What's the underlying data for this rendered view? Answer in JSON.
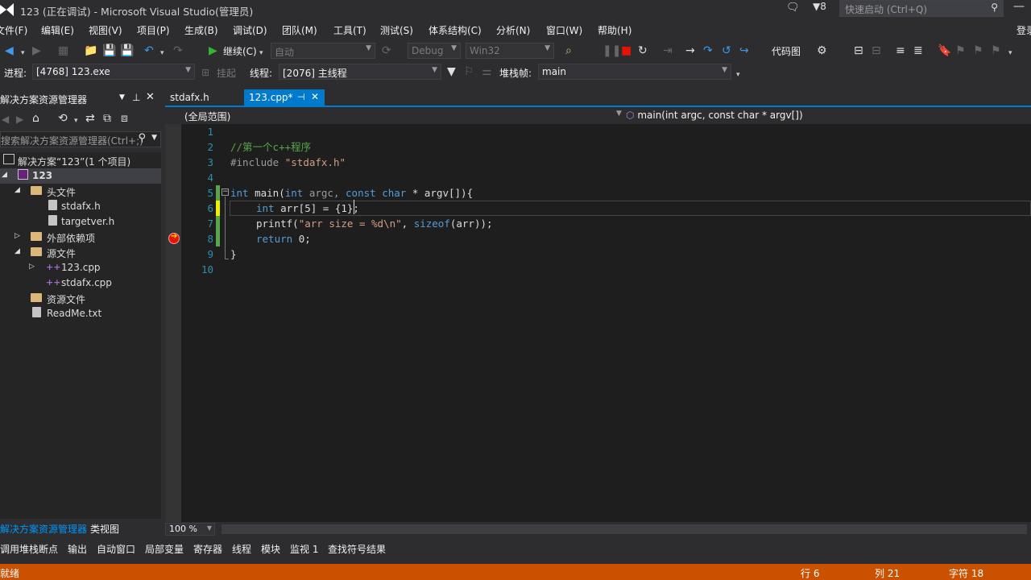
{
  "window": {
    "title": "123 (正在调试) - Microsoft Visual Studio(管理员)",
    "notification_count": "8",
    "quick_launch_placeholder": "快速启动 (Ctrl+Q)",
    "user": "登录"
  },
  "menu": [
    "文件(F)",
    "编辑(E)",
    "视图(V)",
    "项目(P)",
    "生成(B)",
    "调试(D)",
    "团队(M)",
    "工具(T)",
    "测试(S)",
    "体系结构(C)",
    "分析(N)",
    "窗口(W)",
    "帮助(H)"
  ],
  "toolbar": {
    "continue_label": "继续(C)",
    "config_auto": "自动",
    "config_debug": "Debug",
    "platform": "Win32",
    "code_map": "代码图"
  },
  "debug_location": {
    "process_label": "进程:",
    "process_value": "[4768] 123.exe",
    "suspend_label": "挂起",
    "thread_label": "线程:",
    "thread_value": "[2076] 主线程",
    "stack_label": "堆栈帧:",
    "stack_value": "main"
  },
  "solution_explorer": {
    "title": "解决方案资源管理器",
    "search_placeholder": "搜索解决方案资源管理器(Ctrl+;)",
    "tree": {
      "solution": "解决方案“123”(1 个项目)",
      "project": "123",
      "headers": "头文件",
      "stdafx_h": "stdafx.h",
      "targetver_h": "targetver.h",
      "external_deps": "外部依赖项",
      "sources": "源文件",
      "cpp_123": "123.cpp",
      "stdafx_cpp": "stdafx.cpp",
      "resources": "资源文件",
      "readme": "ReadMe.txt"
    },
    "bottom_tabs": [
      "解决方案资源管理器",
      "类视图"
    ]
  },
  "editor": {
    "tabs": [
      {
        "label": "stdafx.h",
        "active": false
      },
      {
        "label": "123.cpp*",
        "active": true
      }
    ],
    "scope": "(全局范围)",
    "function": "main(int argc, const char * argv[])",
    "zoom": "100 %",
    "line_numbers": [
      "1",
      "2",
      "3",
      "4",
      "5",
      "6",
      "7",
      "8",
      "9",
      "10"
    ],
    "code": {
      "l2": "//第一个c++程序",
      "l3_directive": "#include",
      "l3_file": "\"stdafx.h\"",
      "l5_int": "int",
      "l5_main": "main(",
      "l5_int2": "int",
      "l5_argc": "argc,",
      "l5_const": "const",
      "l5_char": "char",
      "l5_rest": "* argv[]){",
      "l6_int": "int",
      "l6_rest": "arr[5] = {1};",
      "l7_printf": "printf(",
      "l7_str": "\"arr size = %d\\n\"",
      "l7_comma": ", ",
      "l7_sizeof": "sizeof",
      "l7_rest": "(arr));",
      "l8_return": "return",
      "l8_rest": "0;",
      "l9": "}"
    }
  },
  "debug_tabs": [
    "调用堆栈",
    "断点",
    "输出",
    "自动窗口",
    "局部变量",
    "寄存器",
    "线程",
    "模块",
    "监视 1",
    "查找符号结果"
  ],
  "status": {
    "left": "就绪",
    "line": "行 6",
    "col": "列 21",
    "char": "字符 18"
  },
  "colors": {
    "accent": "#007acc",
    "status_debug": "#ca5100",
    "editor_bg": "#1e1e1e"
  }
}
